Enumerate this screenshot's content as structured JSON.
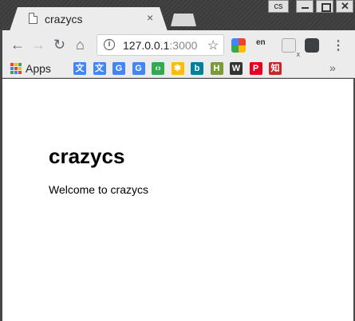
{
  "window": {
    "profile_label": "cs",
    "close_symbol": "✕"
  },
  "tab": {
    "title": "crazycs",
    "close_symbol": "×"
  },
  "toolbar": {
    "back_symbol": "←",
    "forward_symbol": "→",
    "reload_symbol": "↻",
    "home_symbol": "⌂",
    "info_symbol": "i",
    "url_host": "127.0.0.1",
    "url_port": ":3000",
    "star_symbol": "☆",
    "en_ext_label": "en",
    "x_ext_label": "x",
    "menu_symbol": "⋮"
  },
  "bookmarks": {
    "apps_label": "Apps",
    "items": [
      {
        "icon": "google-translate-icon",
        "glyph": "文",
        "color": "#4285f4"
      },
      {
        "icon": "google-translate-icon",
        "glyph": "文",
        "color": "#4285f4"
      },
      {
        "icon": "google-icon",
        "glyph": "G",
        "color": "#4285f4"
      },
      {
        "icon": "google-icon",
        "glyph": "G",
        "color": "#4285f4"
      },
      {
        "icon": "google-developers-icon",
        "glyph": "‹›",
        "color": "#34a853"
      },
      {
        "icon": "google-photos-icon",
        "glyph": "✱",
        "color": "#fbbc05"
      },
      {
        "icon": "bing-icon",
        "glyph": "b",
        "color": "#00809d"
      },
      {
        "icon": "wh-icon",
        "glyph": "H",
        "color": "#7b9a3c"
      },
      {
        "icon": "wikipedia-icon",
        "glyph": "W",
        "color": "#333333"
      },
      {
        "icon": "pinterest-icon",
        "glyph": "P",
        "color": "#e60023"
      },
      {
        "icon": "zhihu-icon",
        "glyph": "知",
        "color": "#c62828"
      }
    ],
    "more_symbol": "»"
  },
  "page": {
    "heading": "crazycs",
    "text": "Welcome to crazycs"
  },
  "colors": {
    "frame": "#474747",
    "toolbar": "#ececec",
    "page_bg": "#ffffff"
  }
}
